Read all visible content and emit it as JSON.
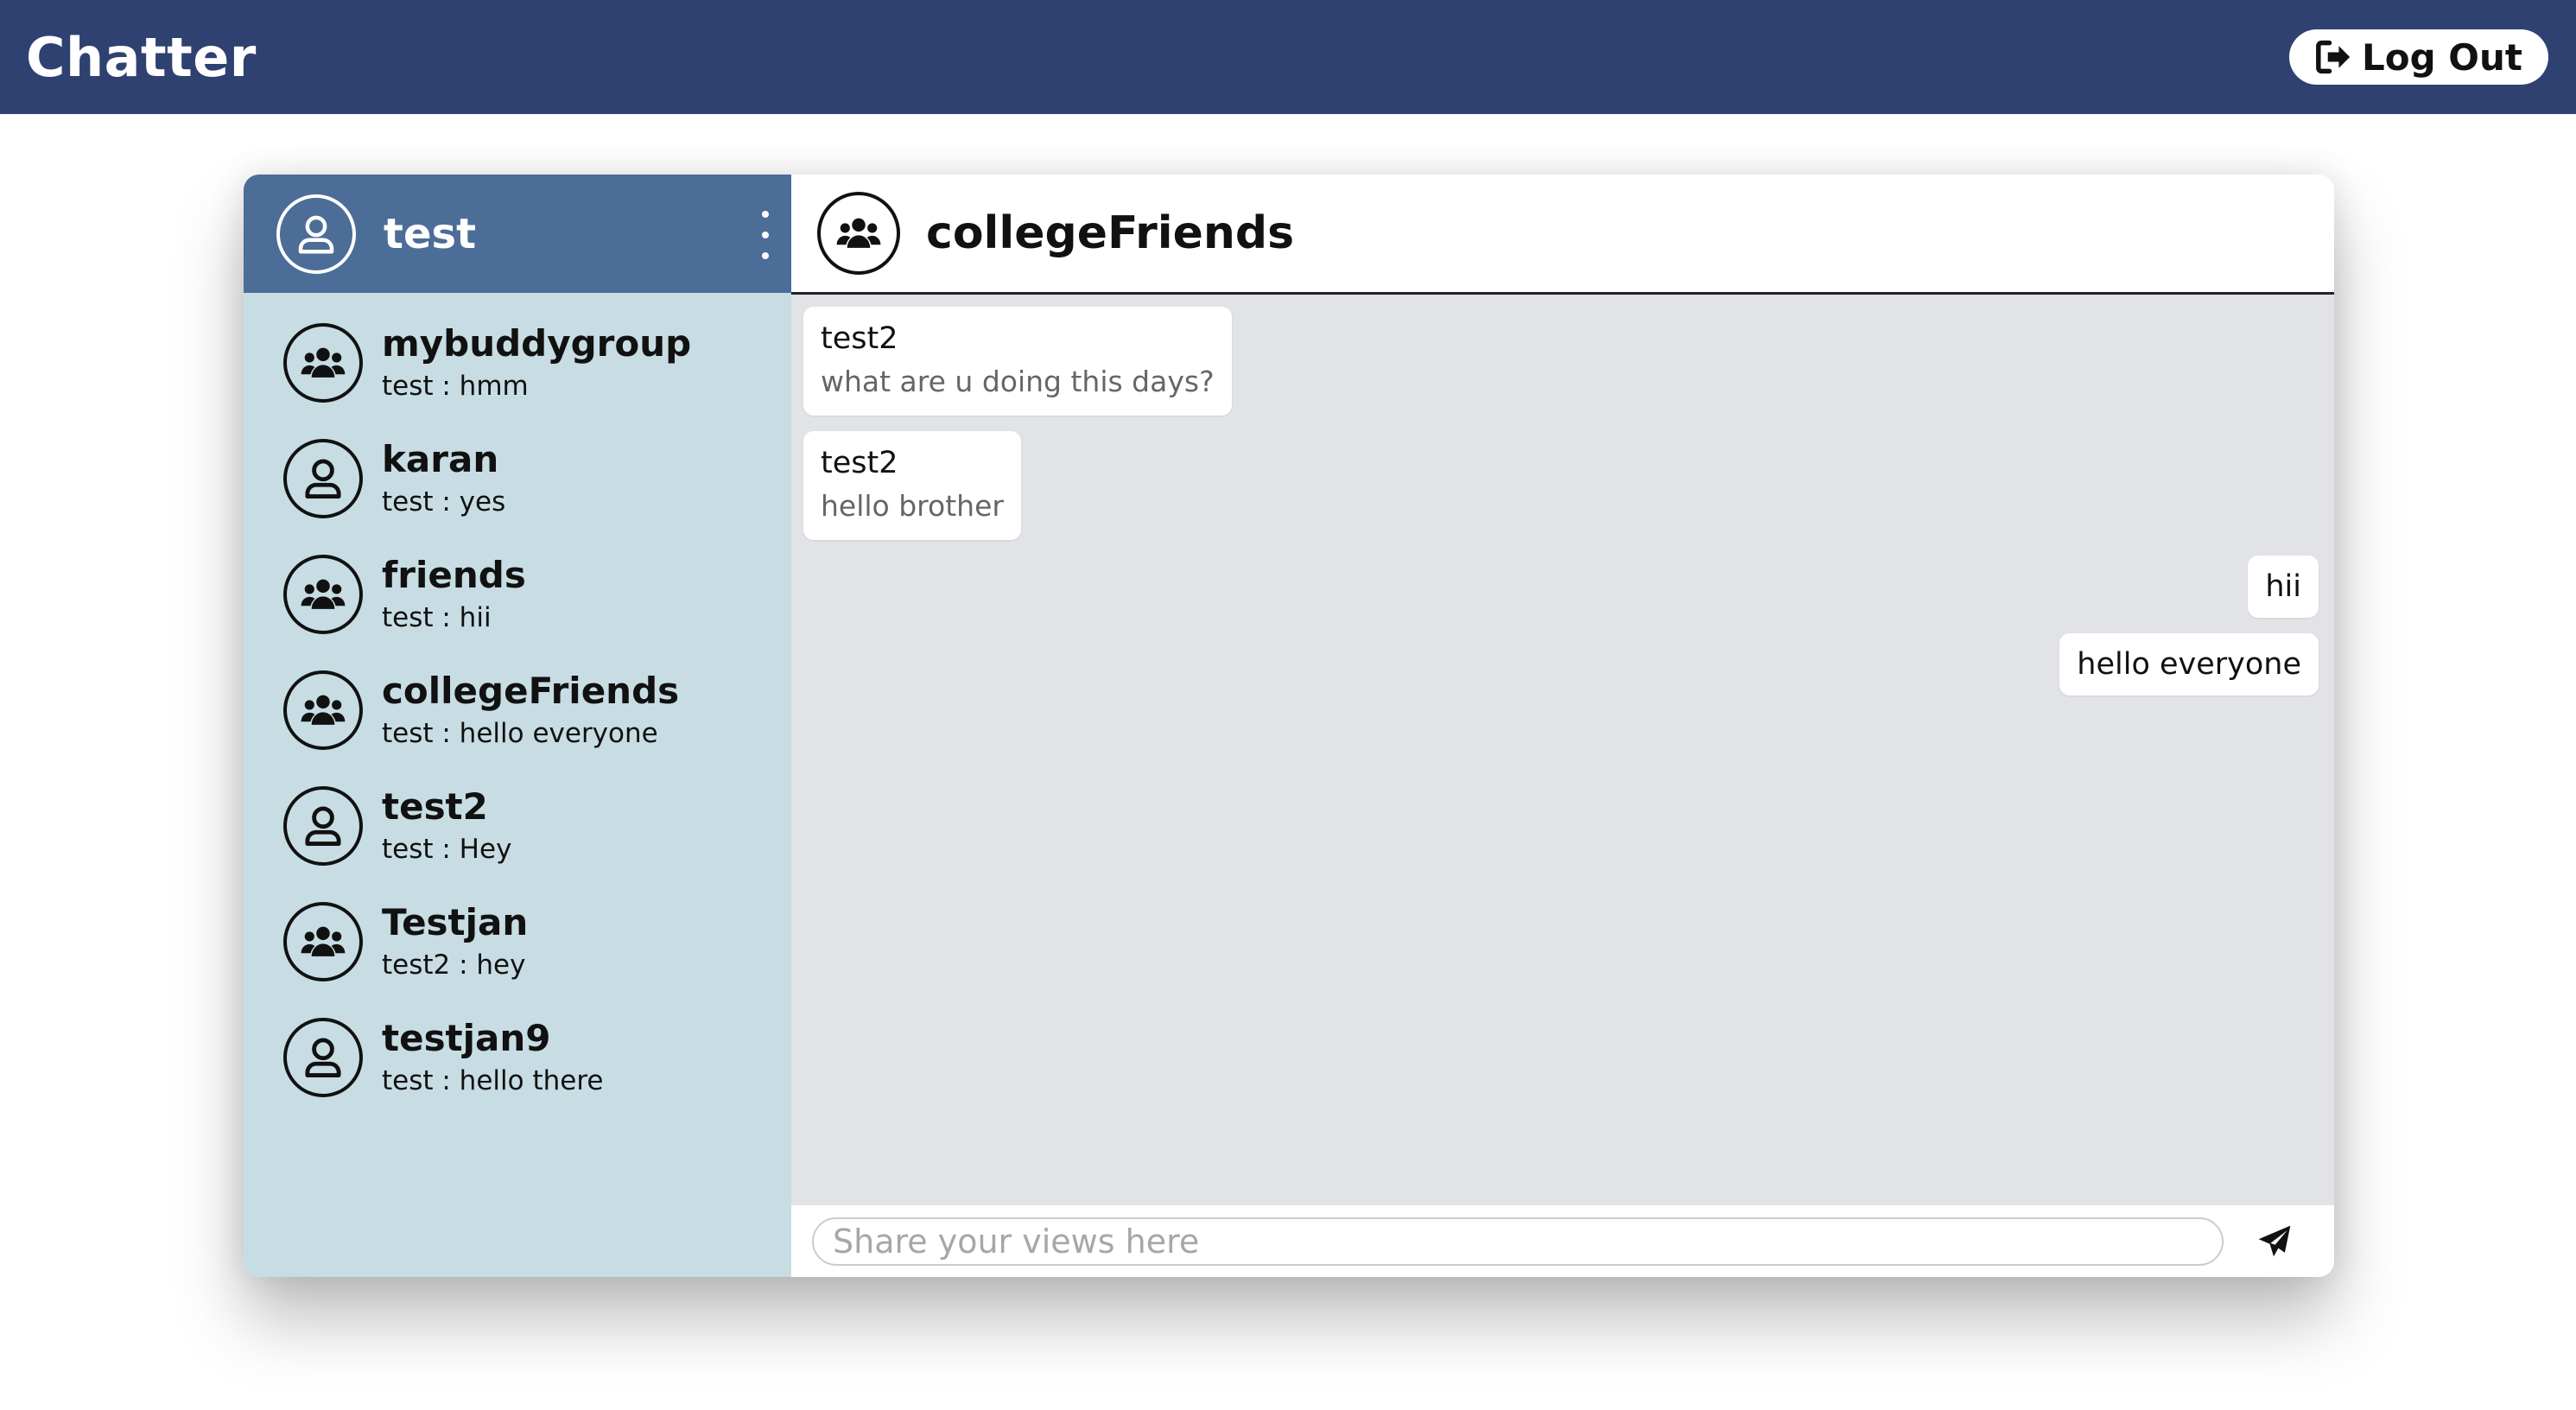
{
  "app": {
    "title": "Chatter"
  },
  "header": {
    "logout_label": "Log Out"
  },
  "sidebar": {
    "current_user": "test",
    "conversations": [
      {
        "name": "mybuddygroup",
        "last_message": "test : hmm",
        "kind": "group"
      },
      {
        "name": "karan",
        "last_message": "test : yes",
        "kind": "user"
      },
      {
        "name": "friends",
        "last_message": "test : hii",
        "kind": "group"
      },
      {
        "name": "collegeFriends",
        "last_message": "test : hello everyone",
        "kind": "group"
      },
      {
        "name": "test2",
        "last_message": "test : Hey",
        "kind": "user"
      },
      {
        "name": "Testjan",
        "last_message": "test2 : hey",
        "kind": "group"
      },
      {
        "name": "testjan9",
        "last_message": "test : hello there",
        "kind": "user"
      }
    ]
  },
  "chat": {
    "title": "collegeFriends",
    "messages": [
      {
        "direction": "in",
        "sender": "test2",
        "text": "what are u doing this days?"
      },
      {
        "direction": "in",
        "sender": "test2",
        "text": "hello brother"
      },
      {
        "direction": "out",
        "text": "hii"
      },
      {
        "direction": "out",
        "text": "hello everyone"
      }
    ],
    "composer_placeholder": "Share your views here"
  },
  "colors": {
    "topbar": "#2e4170",
    "sidebar_header": "#4b6d98",
    "sidebar_bg": "#c7dde3",
    "chat_bg": "#e1e3e7"
  },
  "icons": {
    "user": "user-circle-icon",
    "group": "group-icon",
    "logout": "sign-out-icon",
    "send": "paper-plane-icon",
    "menu": "kebab-menu-icon"
  }
}
